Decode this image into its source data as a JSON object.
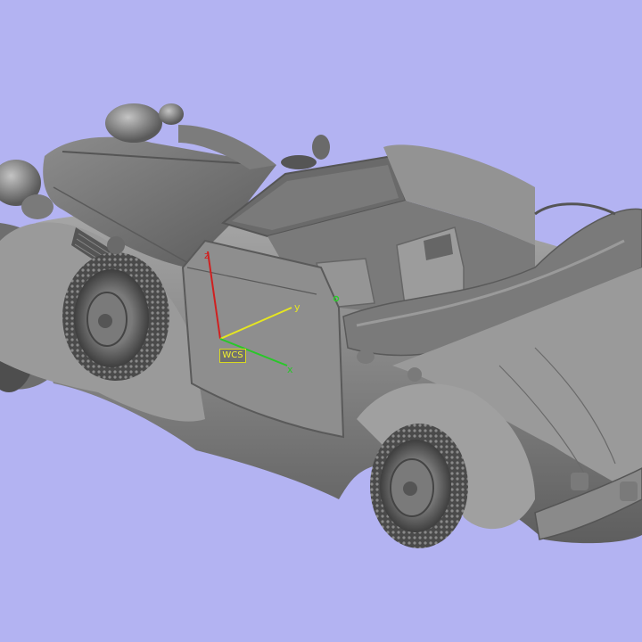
{
  "viewport": {
    "background_color": "#b3b3f2",
    "model": "convertible-roadster",
    "model_color": "#8a8a8a"
  },
  "triad": {
    "tag": "WCS",
    "x_label": "x",
    "y_label": "y",
    "z_label": "z",
    "x_color": "#28c828",
    "y_color": "#e6e620",
    "z_color": "#d02020",
    "tag_color": "#f2f230"
  }
}
